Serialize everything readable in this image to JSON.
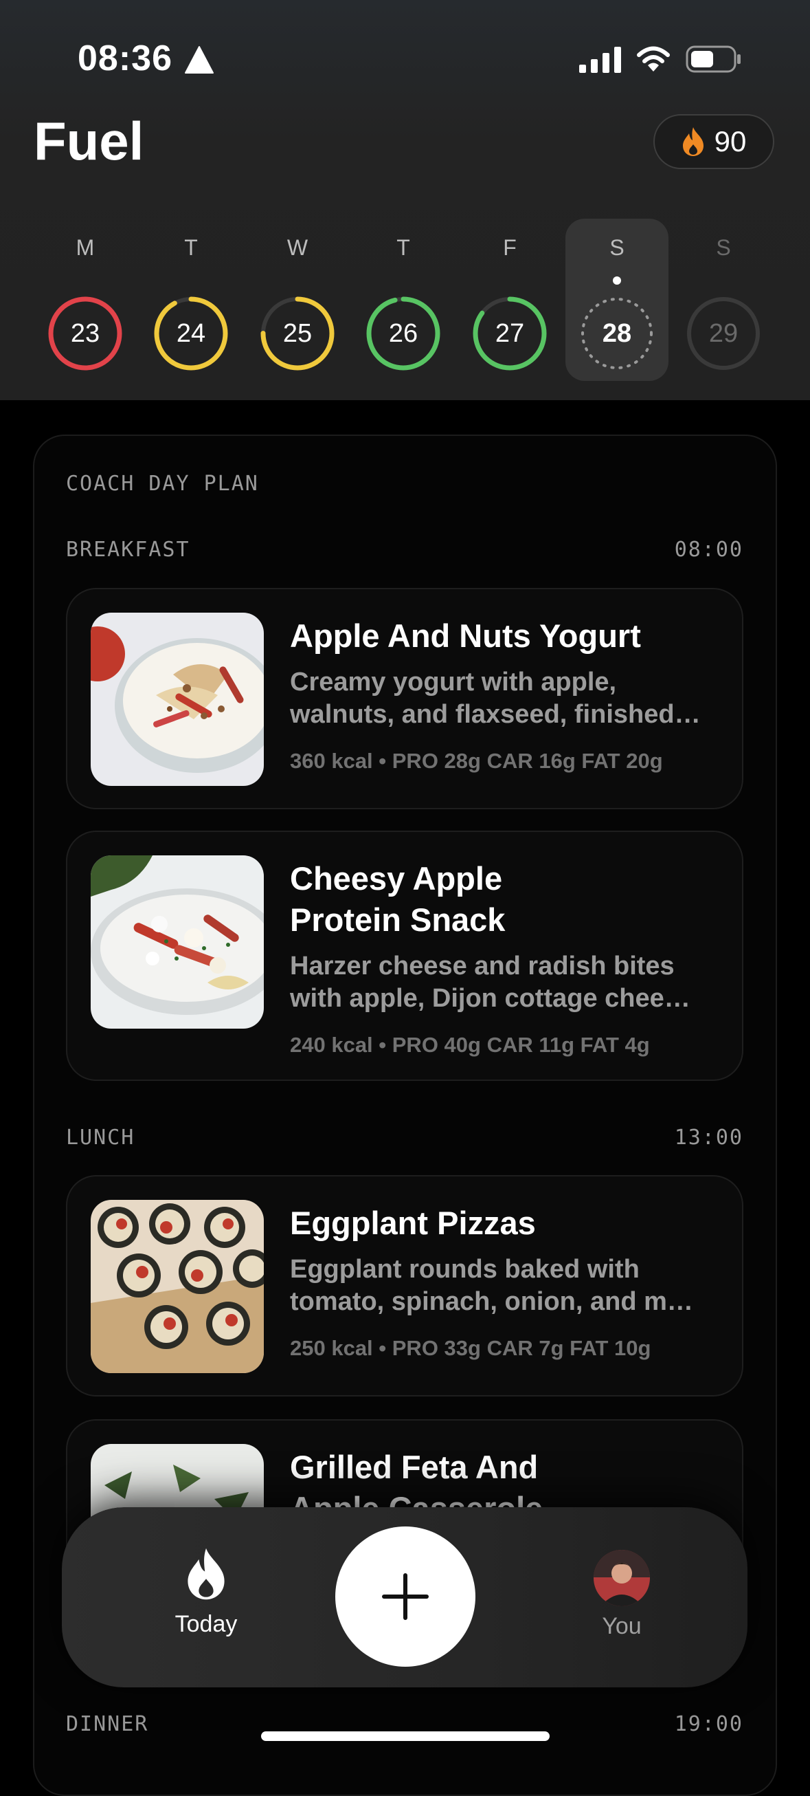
{
  "status": {
    "time": "08:36"
  },
  "header": {
    "title": "Fuel",
    "streak": "90"
  },
  "week": [
    {
      "label": "M",
      "day": "23",
      "ring": "#e2434a",
      "progress": 1.0,
      "selected": false,
      "dim": false
    },
    {
      "label": "T",
      "day": "24",
      "ring": "#f0c93c",
      "progress": 0.92,
      "selected": false,
      "dim": false
    },
    {
      "label": "W",
      "day": "25",
      "ring": "#f0c93c",
      "progress": 0.75,
      "selected": false,
      "dim": false
    },
    {
      "label": "T",
      "day": "26",
      "ring": "#58c463",
      "progress": 0.96,
      "selected": false,
      "dim": false
    },
    {
      "label": "F",
      "day": "27",
      "ring": "#58c463",
      "progress": 0.85,
      "selected": false,
      "dim": false
    },
    {
      "label": "S",
      "day": "28",
      "ring": "#9a9a9a",
      "progress": 0,
      "selected": true,
      "dim": false
    },
    {
      "label": "S",
      "day": "29",
      "ring": "#3a3a3a",
      "progress": 0,
      "selected": false,
      "dim": true
    }
  ],
  "plan": {
    "heading": "COACH DAY PLAN",
    "breakfast": {
      "label": "BREAKFAST",
      "time": "08:00"
    },
    "lunch": {
      "label": "LUNCH",
      "time": "13:00"
    },
    "dinner": {
      "label": "DINNER",
      "time": "19:00"
    },
    "meals": [
      {
        "title": "Apple And Nuts Yogurt",
        "desc": "Creamy yogurt with apple, walnuts, and flaxseed, finished…",
        "macros": "360 kcal • PRO 28g  CAR 16g  FAT 20g"
      },
      {
        "title": "Cheesy Apple Protein Snack",
        "desc": "Harzer cheese and radish bites with apple, Dijon cottage chee…",
        "macros": "240 kcal • PRO 40g  CAR 11g  FAT 4g"
      },
      {
        "title": "Eggplant Pizzas",
        "desc": "Eggplant rounds baked with tomato, spinach, onion, and m…",
        "macros": "250 kcal • PRO 33g  CAR 7g  FAT 10g"
      },
      {
        "title": "Grilled Feta And Apple Casserole"
      }
    ]
  },
  "tabbar": {
    "today": "Today",
    "you": "You"
  }
}
